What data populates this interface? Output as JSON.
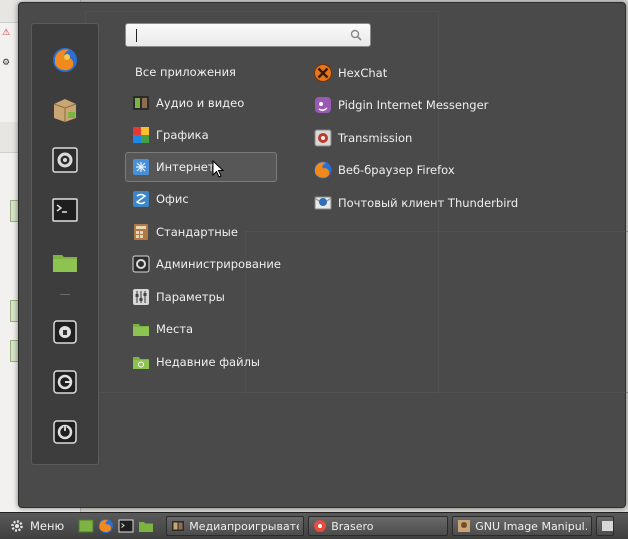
{
  "search": {
    "value": "",
    "placeholder": ""
  },
  "categories_header": "Все приложения",
  "categories": [
    {
      "label": "Аудио и видео",
      "icon": "audio-video-icon"
    },
    {
      "label": "Графика",
      "icon": "graphics-icon"
    },
    {
      "label": "Интернет",
      "icon": "internet-icon"
    },
    {
      "label": "Офис",
      "icon": "office-icon"
    },
    {
      "label": "Стандартные",
      "icon": "accessories-icon"
    },
    {
      "label": "Администрирование",
      "icon": "administration-icon"
    },
    {
      "label": "Параметры",
      "icon": "preferences-icon"
    },
    {
      "label": "Места",
      "icon": "places-folder-icon"
    },
    {
      "label": "Недавние файлы",
      "icon": "recent-files-folder-icon"
    }
  ],
  "active_category": "Интернет",
  "applications": [
    {
      "label": "HexChat",
      "icon": "hexchat-icon"
    },
    {
      "label": "Pidgin Internet Messenger",
      "icon": "pidgin-icon"
    },
    {
      "label": "Transmission",
      "icon": "transmission-icon"
    },
    {
      "label": "Веб-браузер Firefox",
      "icon": "firefox-icon"
    },
    {
      "label": "Почтовый клиент Thunderbird",
      "icon": "thunderbird-icon"
    }
  ],
  "favorites": [
    "firefox-icon",
    "package-manager-icon",
    "system-settings-icon",
    "terminal-icon",
    "folder-icon",
    "lock-screen-icon",
    "logout-icon",
    "shutdown-icon"
  ],
  "taskbar": {
    "menu_label": "Меню",
    "tasks": [
      {
        "label": "Медиапроигрывате...",
        "icon": "media-player-icon"
      },
      {
        "label": "Brasero",
        "icon": "brasero-icon"
      },
      {
        "label": "GNU Image Manipul...",
        "icon": "gimp-icon"
      }
    ]
  },
  "colors": {
    "menu_bg": "#4a4a4a",
    "favorites_bg": "#3d3d3d",
    "accent_green": "#7cb342"
  }
}
